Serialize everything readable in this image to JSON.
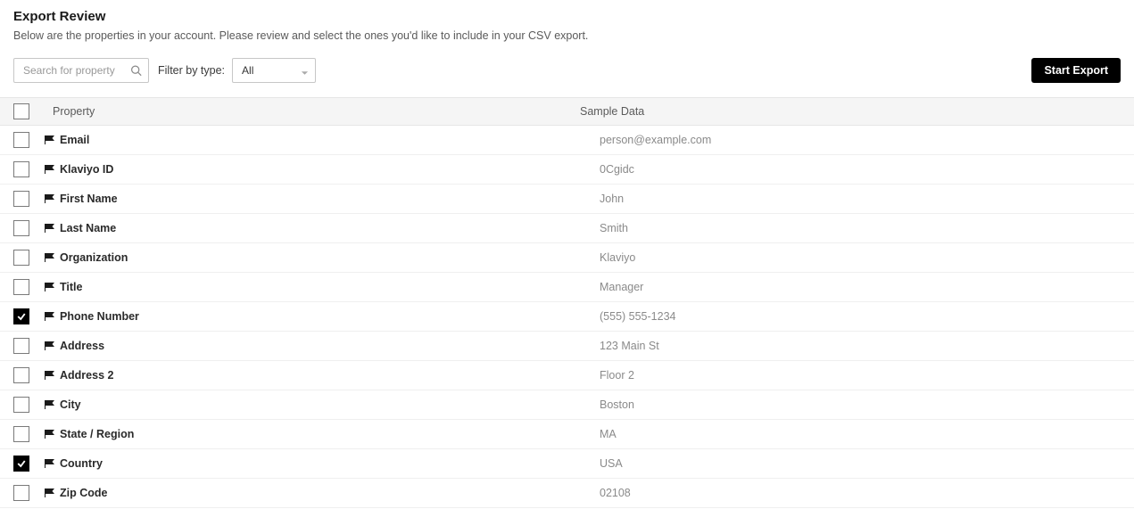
{
  "header": {
    "title": "Export Review",
    "subtitle": "Below are the properties in your account. Please review and select the ones you'd like to include in your CSV export."
  },
  "toolbar": {
    "search_placeholder": "Search for property",
    "filter_label": "Filter by type:",
    "filter_value": "All",
    "start_export_label": "Start Export"
  },
  "table": {
    "headers": {
      "property": "Property",
      "sample": "Sample Data"
    },
    "rows": [
      {
        "checked": false,
        "property": "Email",
        "sample": "person@example.com"
      },
      {
        "checked": false,
        "property": "Klaviyo ID",
        "sample": "0Cgidc"
      },
      {
        "checked": false,
        "property": "First Name",
        "sample": "John"
      },
      {
        "checked": false,
        "property": "Last Name",
        "sample": "Smith"
      },
      {
        "checked": false,
        "property": "Organization",
        "sample": "Klaviyo"
      },
      {
        "checked": false,
        "property": "Title",
        "sample": "Manager"
      },
      {
        "checked": true,
        "property": "Phone Number",
        "sample": "(555) 555-1234"
      },
      {
        "checked": false,
        "property": "Address",
        "sample": "123 Main St"
      },
      {
        "checked": false,
        "property": "Address 2",
        "sample": "Floor 2"
      },
      {
        "checked": false,
        "property": "City",
        "sample": "Boston"
      },
      {
        "checked": false,
        "property": "State / Region",
        "sample": "MA"
      },
      {
        "checked": true,
        "property": "Country",
        "sample": "USA"
      },
      {
        "checked": false,
        "property": "Zip Code",
        "sample": "02108"
      }
    ]
  }
}
